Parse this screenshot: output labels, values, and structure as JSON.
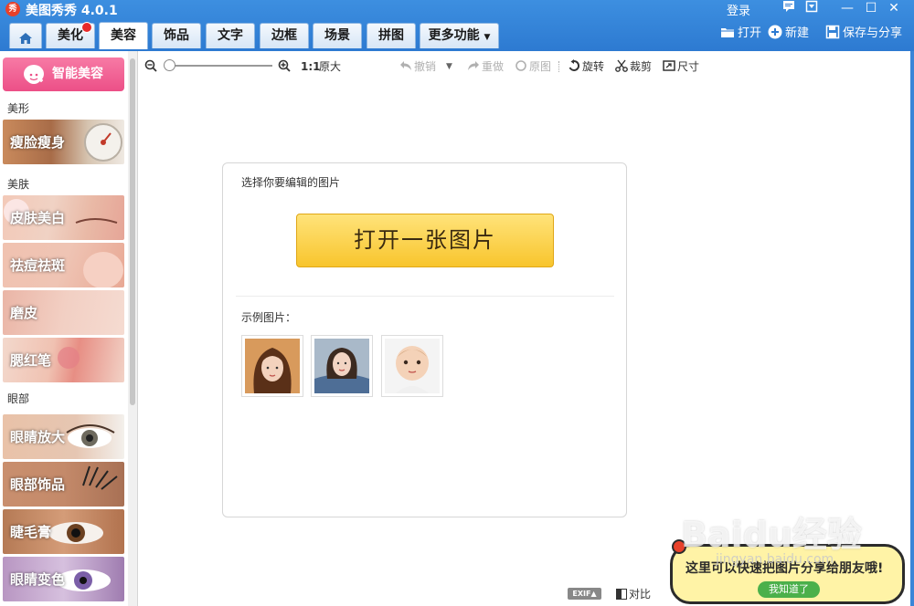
{
  "app": {
    "logo_text": "秀",
    "title": "美图秀秀 4.0.1",
    "login": "登录"
  },
  "window_controls": {
    "minimize": "—",
    "maximize": "☐",
    "close": "✕"
  },
  "tabs": [
    {
      "label": "美化"
    },
    {
      "label": "美容"
    },
    {
      "label": "饰品"
    },
    {
      "label": "文字"
    },
    {
      "label": "边框"
    },
    {
      "label": "场景"
    },
    {
      "label": "拼图"
    },
    {
      "label": "更多功能"
    }
  ],
  "top_actions": {
    "open": "打开",
    "new": "新建",
    "save_share": "保存与分享"
  },
  "sidebar": {
    "smart_button": "智能美容",
    "sections": [
      {
        "label": "美形",
        "items": [
          {
            "label": "瘦脸瘦身"
          }
        ]
      },
      {
        "label": "美肤",
        "items": [
          {
            "label": "皮肤美白"
          },
          {
            "label": "祛痘祛斑"
          },
          {
            "label": "磨皮"
          },
          {
            "label": "腮红笔"
          }
        ]
      },
      {
        "label": "眼部",
        "items": [
          {
            "label": "眼睛放大"
          },
          {
            "label": "眼部饰品"
          },
          {
            "label": "睫毛膏"
          },
          {
            "label": "眼睛变色"
          }
        ]
      }
    ]
  },
  "toolbar": {
    "ratio": "1:1",
    "original_size": "原大",
    "undo": "撤销",
    "redo": "重做",
    "original": "原图",
    "rotate": "旋转",
    "crop": "裁剪",
    "size": "尺寸"
  },
  "card": {
    "prompt": "选择你要编辑的图片",
    "open_button": "打开一张图片",
    "sample_label": "示例图片："
  },
  "statusbar": {
    "exif": "EXIF▲",
    "compare": "对比"
  },
  "tooltip": {
    "text": "这里可以快速把图片分享给朋友哦!",
    "button": "我知道了"
  },
  "watermark": {
    "main": "Baidu经验",
    "sub": "jingyan.baidu.com"
  }
}
